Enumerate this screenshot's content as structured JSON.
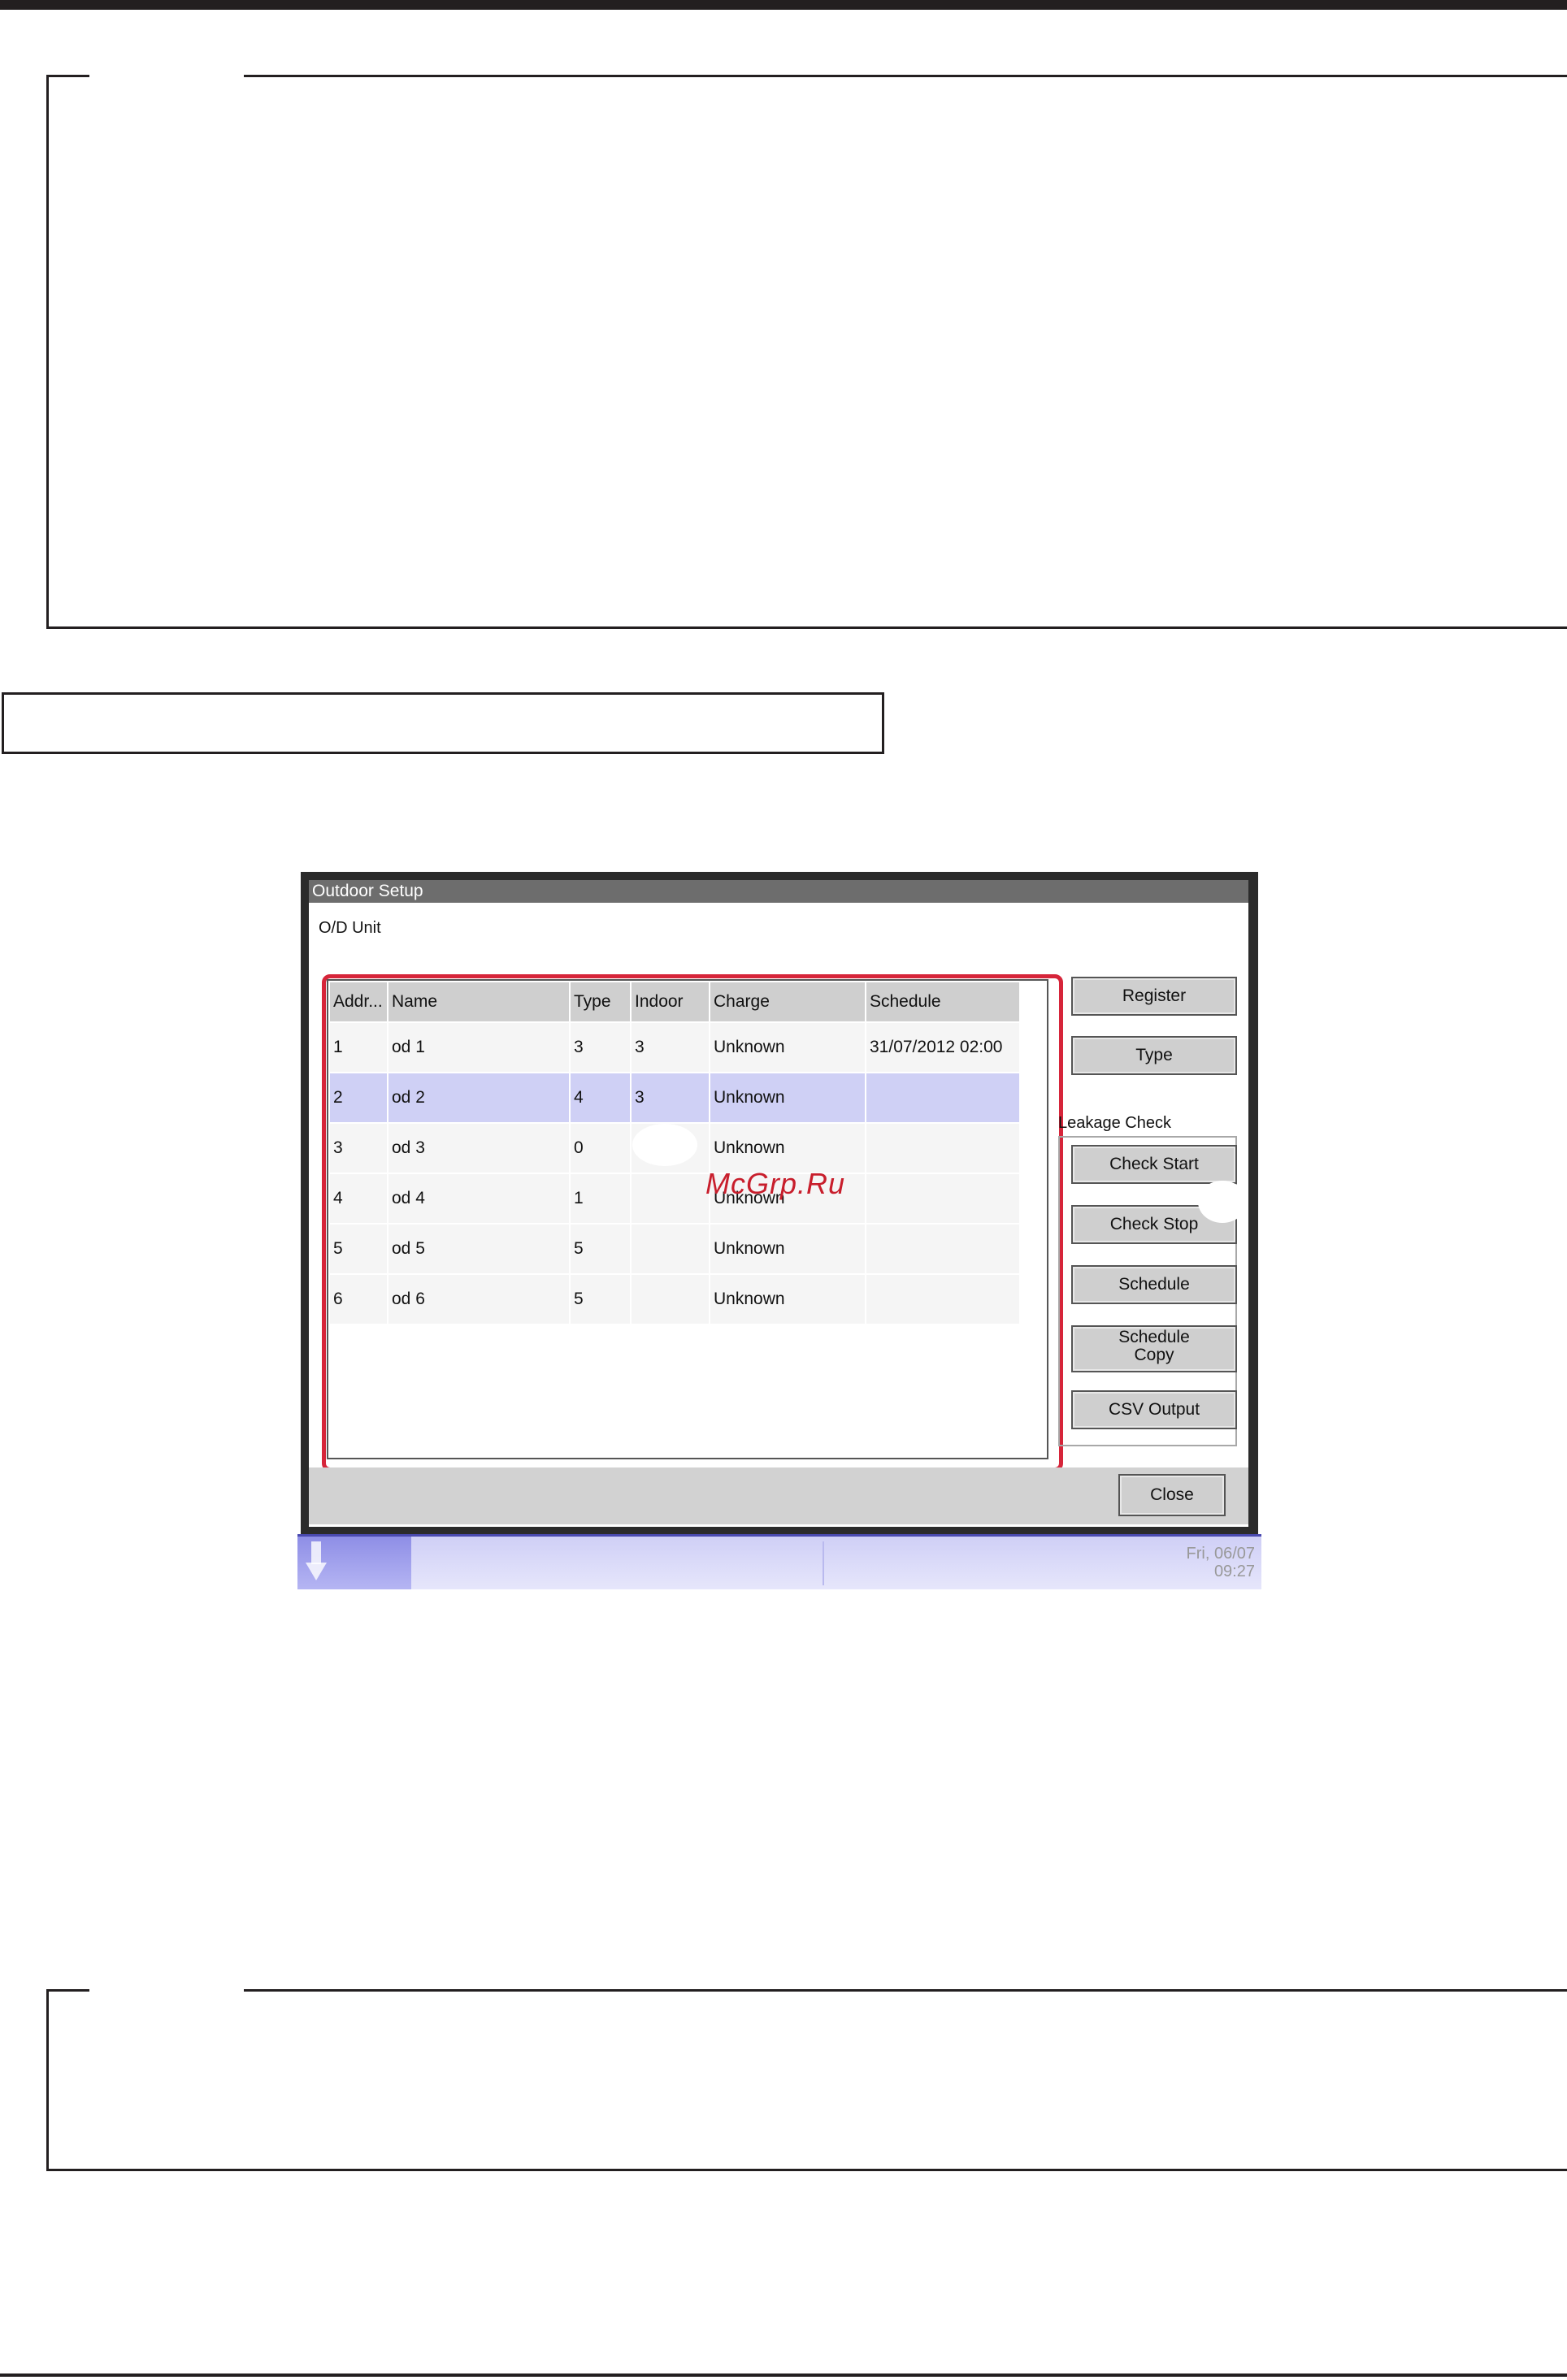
{
  "window": {
    "title": "Outdoor Setup"
  },
  "od_unit": {
    "label": "O/D Unit",
    "columns": [
      "Addr...",
      "Name",
      "Type",
      "Indoor",
      "Charge",
      "Schedule"
    ],
    "rows": [
      {
        "addr": "1",
        "name": "od 1",
        "type": "3",
        "indoor": "3",
        "charge": "Unknown",
        "schedule": "31/07/2012 02:00"
      },
      {
        "addr": "2",
        "name": "od 2",
        "type": "4",
        "indoor": "3",
        "charge": "Unknown",
        "schedule": ""
      },
      {
        "addr": "3",
        "name": "od 3",
        "type": "0",
        "indoor": "",
        "charge": "Unknown",
        "schedule": ""
      },
      {
        "addr": "4",
        "name": "od 4",
        "type": "1",
        "indoor": "",
        "charge": "Unknown",
        "schedule": ""
      },
      {
        "addr": "5",
        "name": "od 5",
        "type": "5",
        "indoor": "",
        "charge": "Unknown",
        "schedule": ""
      },
      {
        "addr": "6",
        "name": "od 6",
        "type": "5",
        "indoor": "",
        "charge": "Unknown",
        "schedule": ""
      }
    ],
    "selected_row": 2
  },
  "buttons": {
    "register": "Register",
    "type": "Type",
    "close": "Close"
  },
  "leakage_check": {
    "label": "Leakage Check",
    "check_start": "Check Start",
    "check_stop": "Check Stop",
    "schedule": "Schedule",
    "schedule_copy_line1": "Schedule",
    "schedule_copy_line2": "Copy",
    "csv_output": "CSV Output"
  },
  "status_bar": {
    "date": "Fri, 06/07",
    "time": "09:27"
  },
  "watermark": "McGrp.Ru",
  "colors": {
    "highlight_outline": "#d6253a",
    "selected_row": "#cfd0f5",
    "status_bar": "#cfcff6"
  }
}
